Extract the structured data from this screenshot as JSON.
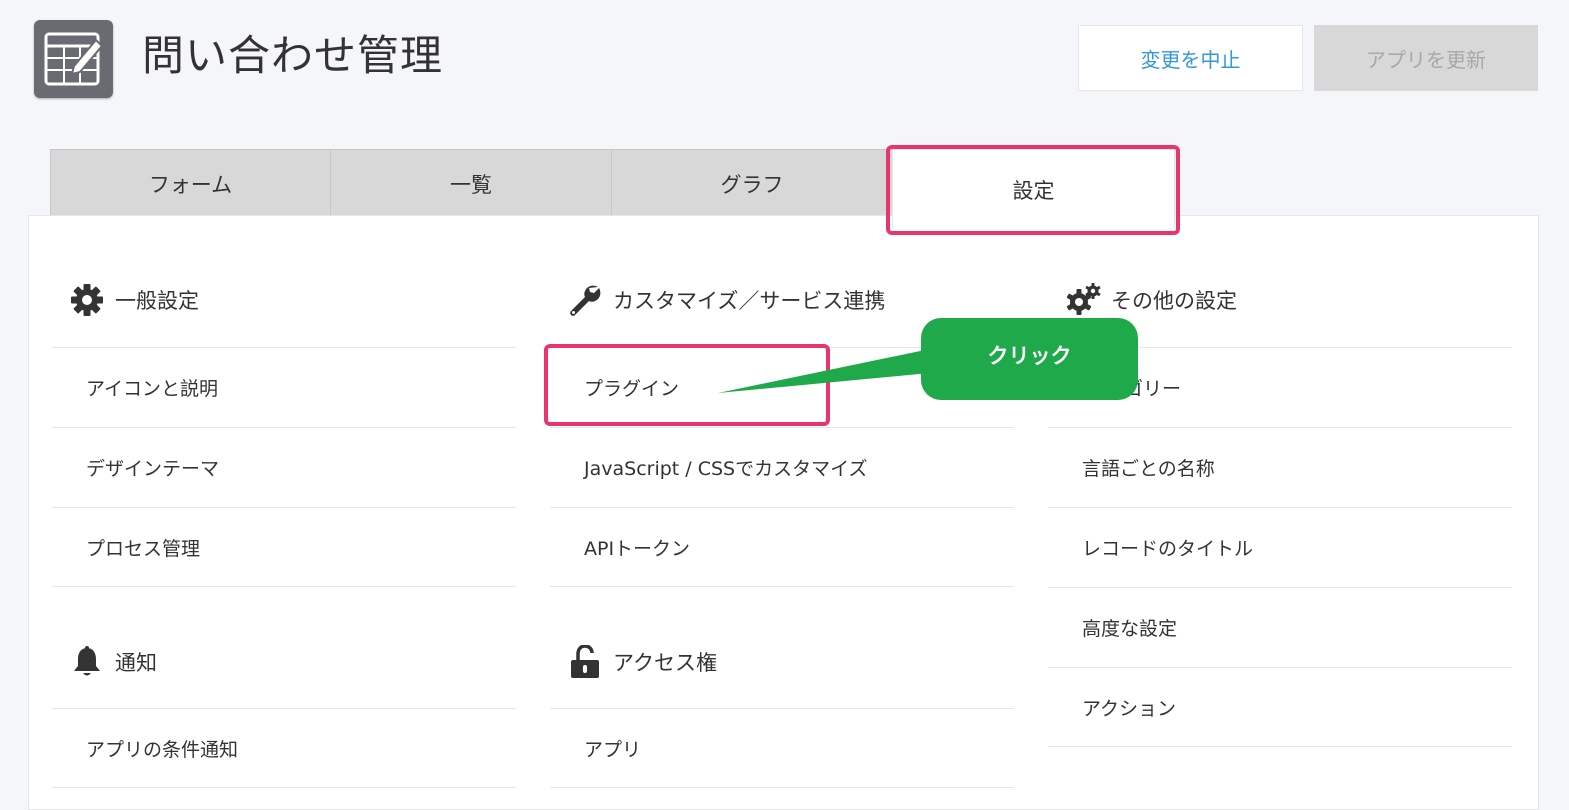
{
  "header": {
    "app_title": "問い合わせ管理",
    "app_icon": "app-form-edit-icon",
    "cancel_label": "変更を中止",
    "update_label": "アプリを更新"
  },
  "tabs": [
    {
      "label": "フォーム"
    },
    {
      "label": "一覧"
    },
    {
      "label": "グラフ"
    },
    {
      "label": "設定",
      "active": true
    }
  ],
  "sections": {
    "general": {
      "title": "一般設定",
      "icon": "gear-icon",
      "items": [
        "アイコンと説明",
        "デザインテーマ",
        "プロセス管理"
      ]
    },
    "notification": {
      "title": "通知",
      "icon": "bell-icon",
      "items": [
        "アプリの条件通知"
      ]
    },
    "customize": {
      "title": "カスタマイズ／サービス連携",
      "icon": "wrench-icon",
      "items": [
        "プラグイン",
        "JavaScript / CSSでカスタマイズ",
        "APIトークン"
      ]
    },
    "access": {
      "title": "アクセス権",
      "icon": "unlock-icon",
      "items": [
        "アプリ"
      ]
    },
    "other": {
      "title": "その他の設定",
      "icon": "gears-icon",
      "items": [
        "ゴリー",
        "言語ごとの名称",
        "レコードのタイトル",
        "高度な設定",
        "アクション"
      ]
    }
  },
  "annotation": {
    "callout_text": "クリック"
  },
  "colors": {
    "highlight": "#e8366d",
    "callout": "#1fa94a",
    "link": "#3498db"
  }
}
